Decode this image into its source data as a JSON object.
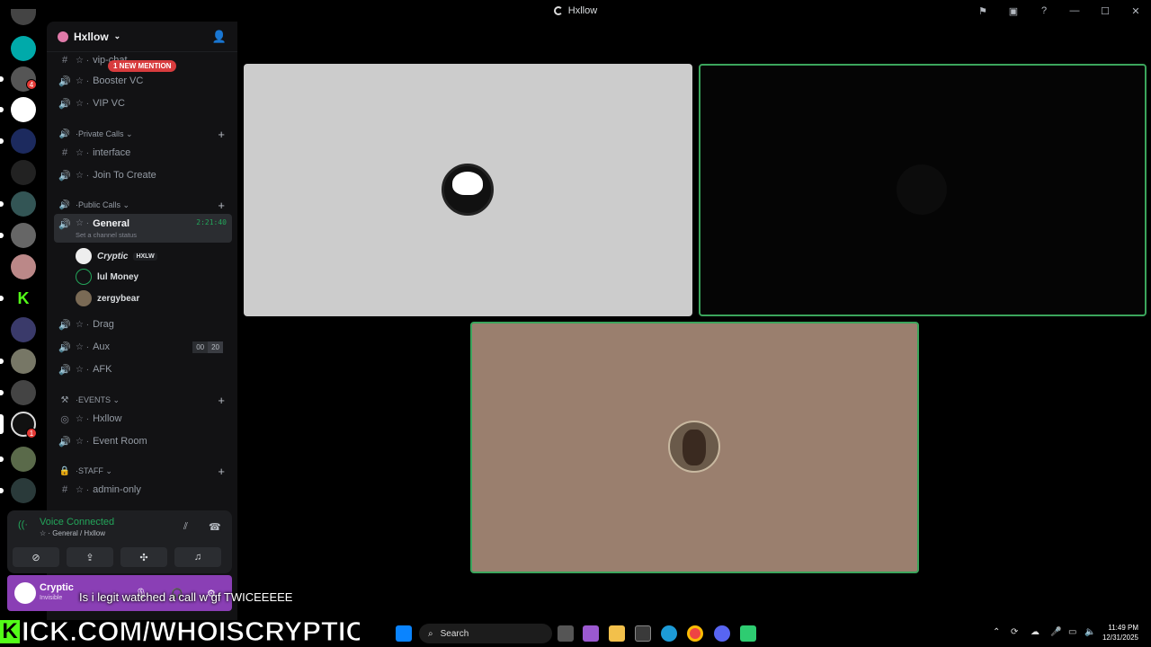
{
  "window": {
    "title": "Hxllow"
  },
  "server": {
    "name": "Hxllow",
    "mention_badge": "1 NEW MENTION",
    "badges": [
      "4",
      "1"
    ]
  },
  "channels": {
    "vip_chat": "vip-chat",
    "booster_vc": "Booster VC",
    "vip_vc": "VIP VC",
    "cat_private": "Private Calls",
    "interface": "interface",
    "join_to_create": "Join To Create",
    "cat_public": "Public Calls",
    "general": "General",
    "general_timer": "2:21:40",
    "general_status": "Set a channel status",
    "drag": "Drag",
    "aux": "Aux",
    "aux_limit": [
      "00",
      "20"
    ],
    "afk": "AFK",
    "cat_events": "EVENTS",
    "hxllow_stage": "Hxllow",
    "event_room": "Event Room",
    "cat_staff": "STAFF",
    "admin_only": "admin-only"
  },
  "voice_users": [
    {
      "name": "Cryptic",
      "tag": "HXLW"
    },
    {
      "name": "lul Money"
    },
    {
      "name": "zergybear"
    }
  ],
  "voice_panel": {
    "status": "Voice Connected",
    "location": "General / Hxllow"
  },
  "user_bar": {
    "name": "Cryptic",
    "status": "Invisible"
  },
  "stream_caption": "Is i legit watched a call w gf TWICEEEEE",
  "overlay": {
    "letter": "K",
    "text": "ICK.COM/WHOISCRYPTIC"
  },
  "taskbar": {
    "search_placeholder": "Search",
    "time": "11:49 PM",
    "date": "12/31/2025"
  },
  "colors": {
    "accent_green": "#23a55a",
    "mention_red": "#d83c3e",
    "tile1_bg": "#cccccc",
    "tile2_bg": "#050505",
    "tile3_bg": "#9a7f6e"
  }
}
